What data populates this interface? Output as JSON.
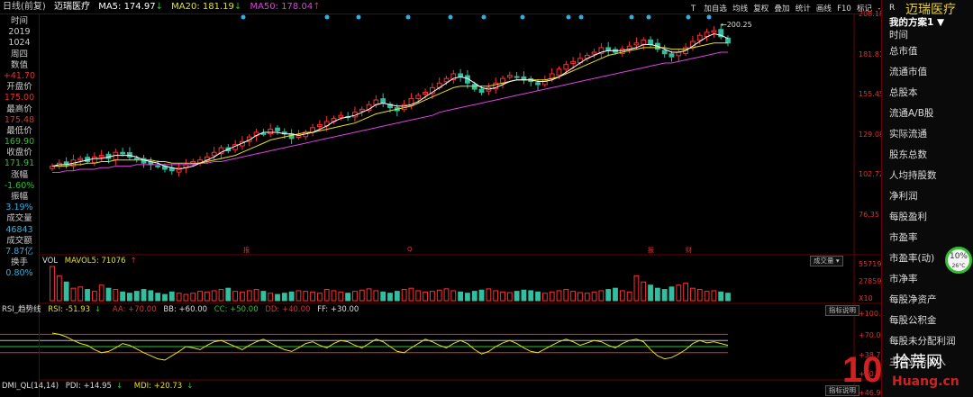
{
  "header": {
    "period": "日线(前复)",
    "stock_name": "迈瑞医疗",
    "ma5_label": "MA5: 174.97",
    "ma20_label": "MA20: 181.19",
    "ma50_label": "MA50: 178.04",
    "ma5_arrow": "↓",
    "ma20_arrow": "↓",
    "ma50_arrow": "↑"
  },
  "toolbar": {
    "buttons": [
      "T",
      "加自选",
      "均线",
      "复权",
      "叠加",
      "统计",
      "画线",
      "F10",
      "标记",
      "-",
      "+",
      "◇"
    ]
  },
  "sidebar": {
    "items": [
      {
        "text": "时间",
        "color": "#cccccc"
      },
      {
        "text": "2019",
        "color": "#cccccc"
      },
      {
        "text": "1024",
        "color": "#cccccc"
      },
      {
        "text": "周四",
        "color": "#cccccc"
      },
      {
        "text": "数值",
        "color": "#cccccc"
      },
      {
        "text": "+41.70",
        "color": "#e03030"
      },
      {
        "text": "开盘价",
        "color": "#cccccc"
      },
      {
        "text": "175.00",
        "color": "#e03030"
      },
      {
        "text": "最高价",
        "color": "#cccccc"
      },
      {
        "text": "175.48",
        "color": "#e03030"
      },
      {
        "text": "最低价",
        "color": "#cccccc"
      },
      {
        "text": "169.90",
        "color": "#30c030"
      },
      {
        "text": "收盘价",
        "color": "#cccccc"
      },
      {
        "text": "171.91",
        "color": "#30c030"
      },
      {
        "text": "涨幅",
        "color": "#cccccc"
      },
      {
        "text": "-1.60%",
        "color": "#30c030"
      },
      {
        "text": "振幅",
        "color": "#cccccc"
      },
      {
        "text": "3.19%",
        "color": "#30b0e0"
      },
      {
        "text": "成交量",
        "color": "#cccccc"
      },
      {
        "text": "46843",
        "color": "#30b0e0"
      },
      {
        "text": "成交额",
        "color": "#cccccc"
      },
      {
        "text": "7.87亿",
        "color": "#30b0e0"
      },
      {
        "text": "换手",
        "color": "#cccccc"
      },
      {
        "text": "0.80%",
        "color": "#30b0e0"
      }
    ]
  },
  "price_axis": {
    "labels": [
      "208.18",
      "181.81",
      "155.45",
      "129.08",
      "102.72",
      "76.35"
    ],
    "high_marker": "200.25"
  },
  "volume": {
    "label": "VOL",
    "mavol_label": "MAVOL5: 71076",
    "mavol_arrow": "↑",
    "axis_labels": [
      "55719",
      "27859",
      "X10"
    ],
    "dropdown": "成交量"
  },
  "rsi": {
    "title": "RSI_趋势线",
    "rsi_val": "RSI: -51.93",
    "rsi_arrow": "↓",
    "aa_val": "AA: +70.00",
    "bb_val": "BB: +60.00",
    "cc_val": "CC: +50.00",
    "dd_val": "DD: +40.00",
    "ff_val": "FF: +30.00",
    "axis_labels": [
      "+100.0",
      "+70.00",
      "+38.73",
      "+10.00"
    ],
    "desc_button": "指标说明"
  },
  "dmi": {
    "title": "DMI_QL(14,14)",
    "pdi_val": "PDI: +14.95",
    "pdi_arrow": "↓",
    "mdi_val": "MDI: +20.73",
    "mdi_arrow": "↓",
    "axis_label": "+46.93",
    "desc_button": "指标说明"
  },
  "event_markers": [
    "报",
    "Q",
    "报",
    "财"
  ],
  "right_panel": {
    "r_label": "R",
    "logo": "迈瑞医疗",
    "plan": "我的方案1",
    "items": [
      "时间",
      "总市值",
      "流通市值",
      "总股本",
      "流通A/B股",
      "实际流通",
      "股东总数",
      "人均持股数",
      "净利润",
      "每股盈利",
      "市盈率",
      "市盈率(动)",
      "市净率",
      "每股净资产",
      "每股公积金",
      "每股未分配利润",
      "主营业务收入"
    ],
    "gauge_value": "10%",
    "gauge_sub": "26°C"
  },
  "watermark": {
    "main": "10",
    "text": "拾荒网",
    "url": "Huang.cn"
  },
  "chart_data": {
    "type": "candlestick",
    "ylim": [
      65,
      210
    ],
    "closes": [
      112,
      114,
      113,
      116,
      117,
      115,
      118,
      119,
      117,
      121,
      120,
      118,
      117,
      114,
      113,
      112,
      110,
      109,
      111,
      113,
      115,
      116,
      118,
      121,
      124,
      122,
      126,
      128,
      131,
      134,
      133,
      136,
      135,
      133,
      130,
      132,
      134,
      137,
      139,
      141,
      143,
      145,
      144,
      147,
      149,
      152,
      155,
      153,
      150,
      148,
      152,
      156,
      158,
      160,
      163,
      166,
      169,
      172,
      170,
      166,
      162,
      160,
      163,
      166,
      169,
      171,
      170,
      168,
      167,
      165,
      168,
      172,
      175,
      178,
      180,
      182,
      184,
      186,
      189,
      187,
      186,
      188,
      190,
      192,
      194,
      191,
      188,
      185,
      183,
      186,
      189,
      193,
      197,
      199,
      200,
      196,
      192
    ],
    "ma5": [
      112,
      113,
      113,
      114,
      115,
      116,
      117,
      117,
      118,
      119,
      119,
      119,
      118,
      116,
      115,
      114,
      112,
      111,
      110,
      111,
      112,
      114,
      116,
      118,
      121,
      123,
      125,
      127,
      129,
      132,
      134,
      134,
      134,
      133,
      133,
      132,
      133,
      134,
      136,
      138,
      141,
      143,
      144,
      145,
      147,
      149,
      152,
      153,
      152,
      151,
      151,
      152,
      154,
      157,
      160,
      163,
      166,
      169,
      170,
      169,
      166,
      163,
      162,
      163,
      165,
      167,
      168,
      168,
      168,
      167,
      167,
      168,
      170,
      173,
      176,
      179,
      182,
      184,
      186,
      187,
      187,
      187,
      188,
      189,
      191,
      191,
      190,
      188,
      186,
      186,
      187,
      190,
      193,
      196,
      198,
      197,
      195
    ],
    "ma20": [
      112,
      112,
      112,
      113,
      113,
      114,
      114,
      115,
      115,
      116,
      116,
      116,
      116,
      116,
      116,
      115,
      115,
      114,
      114,
      114,
      114,
      114,
      115,
      116,
      117,
      118,
      119,
      121,
      123,
      125,
      127,
      129,
      130,
      131,
      132,
      133,
      134,
      134,
      135,
      136,
      137,
      138,
      139,
      140,
      142,
      144,
      146,
      147,
      148,
      149,
      150,
      151,
      153,
      155,
      157,
      159,
      161,
      163,
      164,
      164,
      164,
      164,
      164,
      165,
      166,
      167,
      168,
      168,
      168,
      168,
      168,
      169,
      170,
      172,
      174,
      176,
      178,
      180,
      182,
      184,
      185,
      186,
      187,
      188,
      189,
      189,
      189,
      189,
      188,
      188,
      188,
      189,
      190,
      191,
      192,
      192,
      192
    ],
    "ma50": [
      108,
      108,
      109,
      109,
      110,
      110,
      110,
      111,
      111,
      112,
      112,
      112,
      113,
      113,
      113,
      113,
      113,
      113,
      113,
      113,
      113,
      114,
      114,
      115,
      115,
      116,
      117,
      118,
      119,
      120,
      121,
      122,
      123,
      124,
      125,
      126,
      127,
      128,
      129,
      130,
      131,
      132,
      133,
      134,
      135,
      136,
      137,
      138,
      139,
      140,
      141,
      142,
      143,
      144,
      145,
      147,
      148,
      149,
      150,
      151,
      152,
      153,
      154,
      155,
      156,
      157,
      158,
      159,
      160,
      161,
      162,
      163,
      164,
      165,
      166,
      167,
      168,
      169,
      170,
      171,
      172,
      173,
      174,
      175,
      176,
      177,
      178,
      179,
      179,
      180,
      181,
      182,
      183,
      184,
      185,
      186,
      186
    ],
    "volumes": [
      55,
      40,
      30,
      20,
      22,
      18,
      15,
      25,
      20,
      18,
      14,
      12,
      15,
      18,
      16,
      12,
      10,
      14,
      12,
      10,
      12,
      15,
      14,
      16,
      18,
      20,
      15,
      14,
      16,
      18,
      15,
      12,
      10,
      12,
      14,
      16,
      15,
      14,
      12,
      18,
      16,
      14,
      12,
      15,
      17,
      19,
      16,
      14,
      12,
      15,
      18,
      20,
      16,
      14,
      15,
      17,
      19,
      16,
      14,
      12,
      15,
      17,
      19,
      16,
      14,
      13,
      15,
      17,
      16,
      14,
      12,
      14,
      16,
      18,
      15,
      13,
      12,
      14,
      16,
      18,
      20,
      16,
      14,
      40,
      30,
      25,
      20,
      18,
      22,
      25,
      28,
      20,
      18,
      15,
      16,
      14,
      12
    ],
    "rsi": [
      72,
      70,
      66,
      60,
      55,
      52,
      45,
      40,
      42,
      48,
      55,
      52,
      46,
      40,
      35,
      30,
      28,
      35,
      42,
      50,
      48,
      45,
      52,
      58,
      60,
      55,
      50,
      45,
      52,
      58,
      62,
      56,
      50,
      45,
      42,
      48,
      55,
      58,
      52,
      48,
      55,
      60,
      58,
      52,
      48,
      55,
      62,
      58,
      50,
      42,
      40,
      48,
      55,
      62,
      58,
      52,
      48,
      55,
      60,
      55,
      45,
      38,
      42,
      50,
      56,
      60,
      55,
      48,
      42,
      40,
      46,
      52,
      58,
      62,
      58,
      52,
      56,
      60,
      58,
      52,
      48,
      55,
      60,
      62,
      58,
      45,
      35,
      30,
      32,
      38,
      45,
      55,
      60,
      56,
      58,
      55,
      52
    ]
  }
}
